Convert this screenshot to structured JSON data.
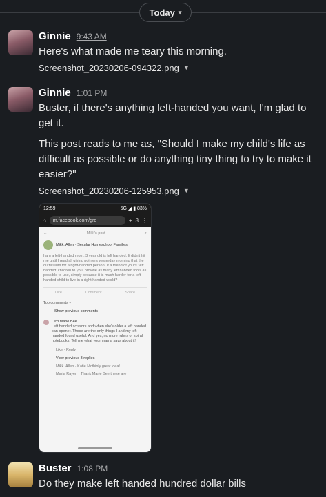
{
  "day_divider": {
    "label": "Today"
  },
  "messages": [
    {
      "author": "Ginnie",
      "time": "9:43 AM",
      "text": "Here's what made me teary this morning.",
      "file": "Screenshot_20230206-094322.png"
    },
    {
      "author": "Ginnie",
      "time": "1:01 PM",
      "text1": "Buster, if there's anything left-handed you want, I'm glad to get it.",
      "text2": "This post reads to me as, \"Should I make my child's life as difficult as possible or do anything tiny thing to try to make it easier?\"",
      "file": "Screenshot_20230206-125953.png"
    },
    {
      "author": "Buster",
      "time": "1:08 PM",
      "text": "Do they make left handed hundred dollar bills"
    }
  ],
  "embedded_screenshot": {
    "status_time": "12:59",
    "status_right": "5G ◢ ▮ 83%",
    "url": "m.facebook.com/gro",
    "tabs_count": "8",
    "header": "Mikk's post",
    "author": "Mikk. Allen · Secular Homeschool Families",
    "post": "I am a left-handed mom. 3 year old is left handed. It didn't hit me until I read all giving pointers yesterday morning that the curriculum for a right-handed person. If a friend of yours 'left handed' children to you, provide as many left handed tools as possible to use, simply because it is much harder for a left-handed child to live in a right handed world?",
    "actions": [
      "Like",
      "Comment",
      "Share"
    ],
    "top_comments": "Top comments ▾",
    "previous_comments": "Show previous comments",
    "commenter": "Lexi Marie Bee",
    "comment": "Left handed scissors and when she's older a left handed can opener. Those are the only things I and my left handed found useful. And yes, no more rulers or spiral notebooks. Tell me what your mama says about it!",
    "reply_meta": "Like · Reply",
    "view_replies": "View previous 3 replies",
    "reply1": "Mikk. Allen · Katie Mcthinly great idea!",
    "reply2": "Maria Rayen · Thank Marie Bee these are"
  },
  "colors": {
    "background": "#1a1d21",
    "name": "#ffffff",
    "text": "#e6e6e6",
    "muted": "#a8a9ab"
  }
}
